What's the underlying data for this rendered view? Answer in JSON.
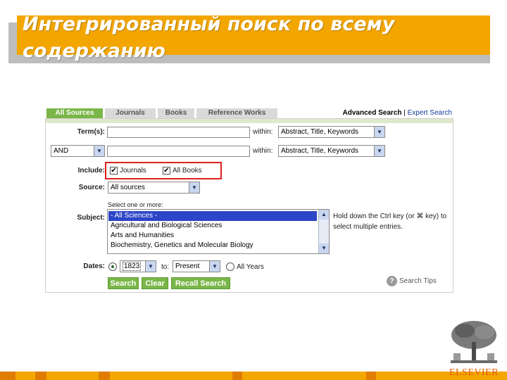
{
  "slide": {
    "title": "Интегрированный поиск по всему содержанию"
  },
  "tabs": [
    {
      "label": "All Sources",
      "active": true
    },
    {
      "label": "Journals",
      "active": false
    },
    {
      "label": "Books",
      "active": false
    },
    {
      "label": "Reference Works",
      "active": false
    }
  ],
  "search_links": {
    "advanced": "Advanced Search",
    "separator": "|",
    "expert": "Expert Search"
  },
  "form": {
    "terms_label": "Term(s):",
    "term1_value": "",
    "term2_value": "",
    "within_label": "within:",
    "within1_value": "Abstract, Title, Keywords",
    "within2_value": "Abstract, Title, Keywords",
    "operator_value": "AND",
    "include_label": "Include:",
    "include_journals": "Journals",
    "include_books": "All Books",
    "journals_checked": true,
    "books_checked": true,
    "source_label": "Source:",
    "source_value": "All sources",
    "select_hint": "Select one or more:",
    "subject_label": "Subject:",
    "subjects": [
      "- All Sciences -",
      "Agricultural and Biological Sciences",
      "Arts and Humanities",
      "Biochemistry, Genetics and Molecular Biology"
    ],
    "subject_selected": "- All Sciences -",
    "subject_hint": "Hold down the Ctrl key (or ⌘ key) to select multiple entries.",
    "dates_label": "Dates:",
    "date_from": "1823",
    "to_label": "to:",
    "date_to": "Present",
    "all_years_label": "All Years",
    "search_button": "Search",
    "clear_button": "Clear",
    "recall_button": "Recall Search",
    "tips_link": "Search Tips"
  },
  "footer": {
    "logo_text": "ELSEVIER"
  },
  "colors": {
    "banner": "#f3a600",
    "tab_active": "#7ab648",
    "highlight_box": "#e0201d",
    "list_selection": "#2d46c8"
  }
}
